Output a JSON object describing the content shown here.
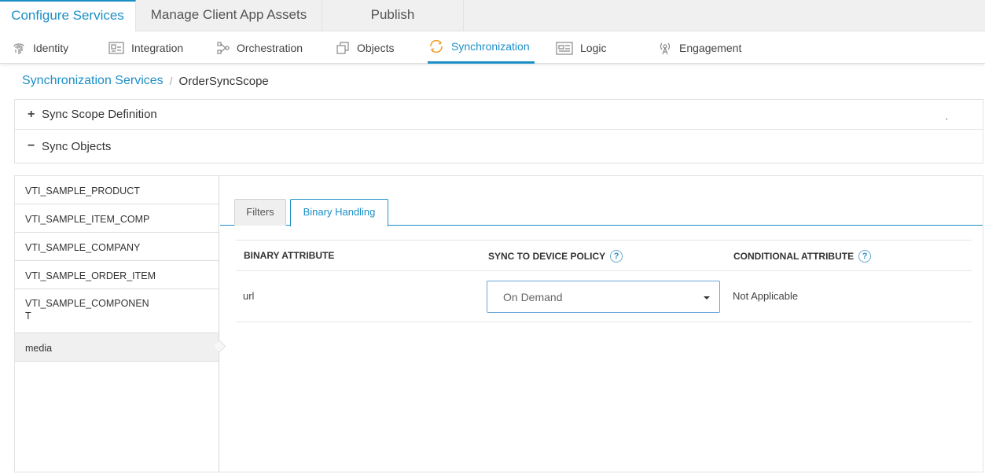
{
  "top_tabs": [
    {
      "label": "Configure Services",
      "active": true
    },
    {
      "label": "Manage Client App Assets",
      "active": false
    },
    {
      "label": "Publish",
      "active": false
    }
  ],
  "sub_nav": [
    {
      "label": "Identity",
      "icon": "fingerprint-icon"
    },
    {
      "label": "Integration",
      "icon": "integration-icon"
    },
    {
      "label": "Orchestration",
      "icon": "orchestration-icon"
    },
    {
      "label": "Objects",
      "icon": "objects-icon"
    },
    {
      "label": "Synchronization",
      "icon": "sync-icon",
      "active": true
    },
    {
      "label": "Logic",
      "icon": "logic-icon"
    },
    {
      "label": "Engagement",
      "icon": "engagement-icon"
    }
  ],
  "breadcrumb": {
    "parent": "Synchronization Services",
    "separator": "/",
    "current": "OrderSyncScope"
  },
  "accordion": {
    "scope_definition": {
      "sign": "+",
      "label": "Sync Scope Definition",
      "dot": "."
    },
    "sync_objects": {
      "sign": "−",
      "label": "Sync Objects"
    }
  },
  "objects": [
    {
      "line1": "VTI_SAMPLE_PRODUCT",
      "line2": ""
    },
    {
      "line1": "VTI_SAMPLE_ITEM_COMP",
      "line2": ""
    },
    {
      "line1": "VTI_SAMPLE_COMPANY",
      "line2": ""
    },
    {
      "line1": "VTI_SAMPLE_ORDER_ITEM",
      "line2": ""
    },
    {
      "line1": "VTI_SAMPLE_COMPONEN",
      "line2": "T"
    },
    {
      "line1": "media",
      "line2": "",
      "selected": true
    }
  ],
  "detail_tabs": [
    {
      "label": "Filters",
      "active": false
    },
    {
      "label": "Binary Handling",
      "active": true
    }
  ],
  "table": {
    "headers": [
      "BINARY ATTRIBUTE",
      "SYNC TO DEVICE POLICY",
      "CONDITIONAL ATTRIBUTE"
    ],
    "help_glyph": "?",
    "rows": [
      {
        "attribute": "url",
        "policy": "On Demand",
        "conditional": "Not Applicable"
      }
    ]
  },
  "colors": {
    "accent": "#1c8fc7",
    "sync_icon": "#f0a030"
  }
}
